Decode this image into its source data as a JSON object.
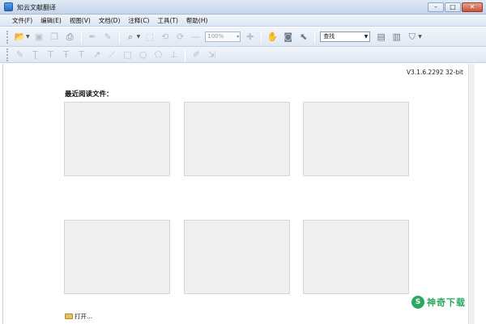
{
  "window": {
    "title": "知云文献翻译",
    "minimize": "–",
    "maximize": "□",
    "close": "✕"
  },
  "menu": [
    "文件(F)",
    "编辑(E)",
    "视图(V)",
    "文档(D)",
    "注释(C)",
    "工具(T)",
    "帮助(H)"
  ],
  "toolbar": {
    "zoom_value": "100%",
    "search_value": "查找"
  },
  "icons": {
    "row1": [
      "open-folder-icon",
      "save-icon",
      "copy-icon",
      "print-icon",
      "pen-tool-icon",
      "highlighter-icon",
      "zoom-in-icon",
      "crop-icon",
      "rotate-left-icon",
      "rotate-right-icon",
      "zoom-out-icon",
      "zoom-plus-icon",
      "hand-tool-icon",
      "snapshot-icon",
      "select-tool-icon",
      "page-properties-icon",
      "page-icon",
      "filter-icon"
    ],
    "row2": [
      "highlight-text-icon",
      "underline-text-icon",
      "text-tool-icon",
      "strikeout-icon",
      "typewriter-icon",
      "arrow-icon",
      "line-icon",
      "rectangle-icon",
      "ellipse-icon",
      "polygon-icon",
      "stamp-icon",
      "note-icon",
      "export-icon"
    ]
  },
  "document": {
    "version": "V3.1.6.2292 32-bit",
    "recent_title": "最近阅读文件：",
    "open_label": "打开..."
  },
  "watermark": {
    "logo": "S",
    "text": "神奇下载"
  }
}
